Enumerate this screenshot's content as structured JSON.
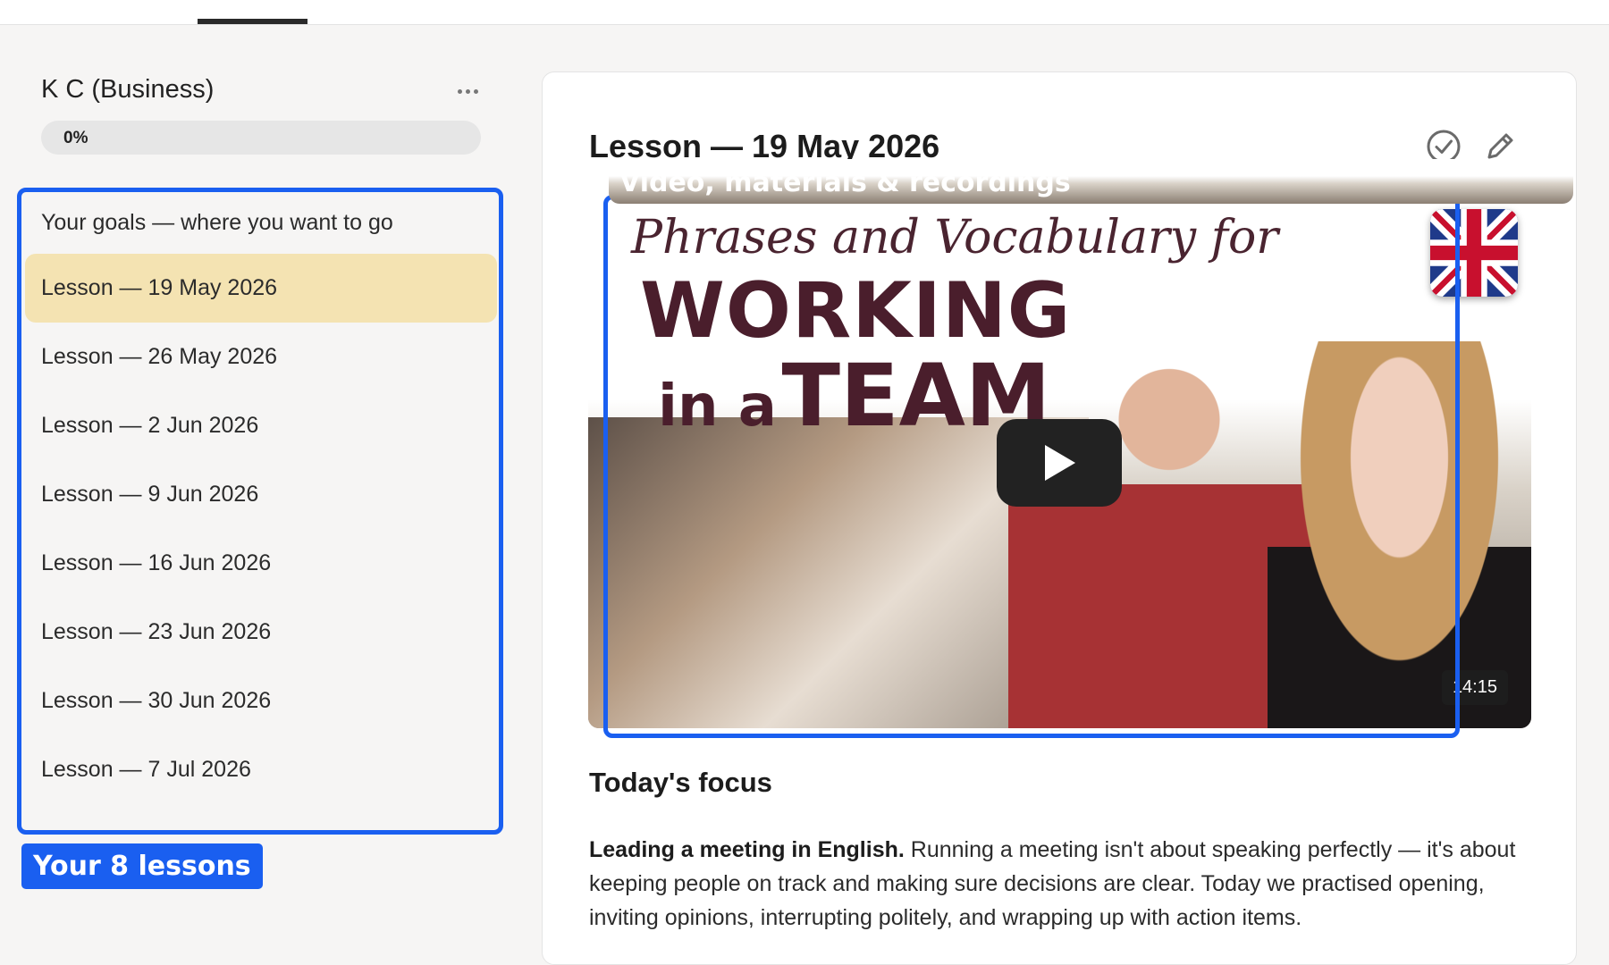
{
  "sidebar": {
    "course_title": "K C (Business)",
    "more_icon": "more-horizontal-icon",
    "progress_label": "0%",
    "progress_value": 0,
    "items": [
      {
        "label": "Your goals — where you want to go",
        "active": false
      },
      {
        "label": "Lesson — 19 May 2026",
        "active": true
      },
      {
        "label": "Lesson — 26 May 2026",
        "active": false
      },
      {
        "label": "Lesson — 2 Jun 2026",
        "active": false
      },
      {
        "label": "Lesson — 9 Jun 2026",
        "active": false
      },
      {
        "label": "Lesson — 16 Jun 2026",
        "active": false
      },
      {
        "label": "Lesson — 23 Jun 2026",
        "active": false
      },
      {
        "label": "Lesson — 30 Jun 2026",
        "active": false
      },
      {
        "label": "Lesson — 7 Jul 2026",
        "active": false
      }
    ],
    "highlight_color": "#f4e3b2"
  },
  "annotations": {
    "lessons_badge": "Your 8 lessons",
    "video_badge": "Video, materials & recordings",
    "color": "#1a5ff0"
  },
  "main": {
    "lesson_title": "Lesson — 19 May 2026",
    "actions": {
      "complete_icon": "check-circle-icon",
      "edit_icon": "pencil-icon"
    },
    "video": {
      "title_line1": "Phrases and Vocabulary for",
      "title_line2": "WORKING",
      "title_line3_small": "in a",
      "title_line3_big": "TEAM",
      "duration": "14:15",
      "play_icon": "play-icon",
      "flag_icon": "uk-flag-icon"
    },
    "focus": {
      "heading": "Today's focus",
      "lead": "Leading a meeting in English.",
      "body": " Running a meeting isn't about speaking perfectly — it's about keeping people on track and making sure decisions are clear. Today we practised opening, inviting opinions, interrupting politely, and wrapping up with action items."
    }
  }
}
